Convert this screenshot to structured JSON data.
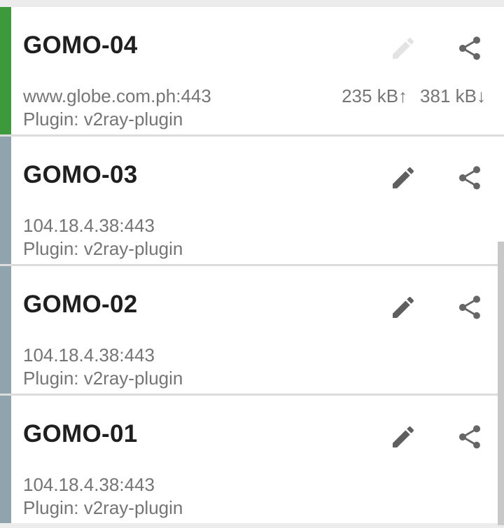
{
  "colors": {
    "active_stripe": "#3c9a3c",
    "inactive_stripe": "#90a4ae",
    "edit_active": "#5f5f5f",
    "edit_disabled": "#e3e3e3",
    "share": "#666666"
  },
  "profiles": [
    {
      "name": "GOMO-04",
      "server": "www.globe.com.ph:443",
      "plugin": "Plugin: v2ray-plugin",
      "tx": "235 kB↑",
      "rx": "381 kB↓",
      "active": true,
      "edit_icon": "pencil-icon",
      "share_icon": "share-icon"
    },
    {
      "name": "GOMO-03",
      "server": "104.18.4.38:443",
      "plugin": "Plugin: v2ray-plugin",
      "tx": "",
      "rx": "",
      "active": false,
      "edit_icon": "pencil-icon",
      "share_icon": "share-icon"
    },
    {
      "name": "GOMO-02",
      "server": "104.18.4.38:443",
      "plugin": "Plugin: v2ray-plugin",
      "tx": "",
      "rx": "",
      "active": false,
      "edit_icon": "pencil-icon",
      "share_icon": "share-icon"
    },
    {
      "name": "GOMO-01",
      "server": "104.18.4.38:443",
      "plugin": "Plugin: v2ray-plugin",
      "tx": "",
      "rx": "",
      "active": false,
      "edit_icon": "pencil-icon",
      "share_icon": "share-icon"
    }
  ]
}
